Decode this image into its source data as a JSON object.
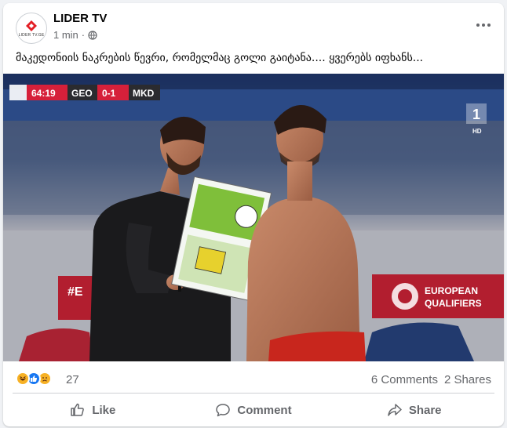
{
  "post": {
    "page_name": "LIDER TV",
    "timestamp": "1 min",
    "avatar_text": "LIDER TV.GE",
    "caption": "მაკედონიის ნაკრების წევრი, რომელმაც გოლი გაიტანა.... ყვერებს იფხანს...",
    "icons": {
      "privacy": "globe-icon",
      "menu": "more-options-icon"
    }
  },
  "media": {
    "scoreboard": {
      "time": "64:19",
      "home": "GEO",
      "score": "0-1",
      "away": "MKD"
    },
    "channel_badge": "HD",
    "banner_text_1": "EUROPEAN",
    "banner_text_2": "QUALIFIERS",
    "banner_left": "#E"
  },
  "engagement": {
    "reaction_count": "27",
    "reactions": [
      "haha",
      "like",
      "sad"
    ],
    "comments": "6 Comments",
    "shares": "2 Shares"
  },
  "actions": {
    "like": "Like",
    "comment": "Comment",
    "share": "Share"
  },
  "colors": {
    "brand_red": "#e31e24",
    "link_blue": "#1877f2",
    "muted": "#65676b"
  }
}
